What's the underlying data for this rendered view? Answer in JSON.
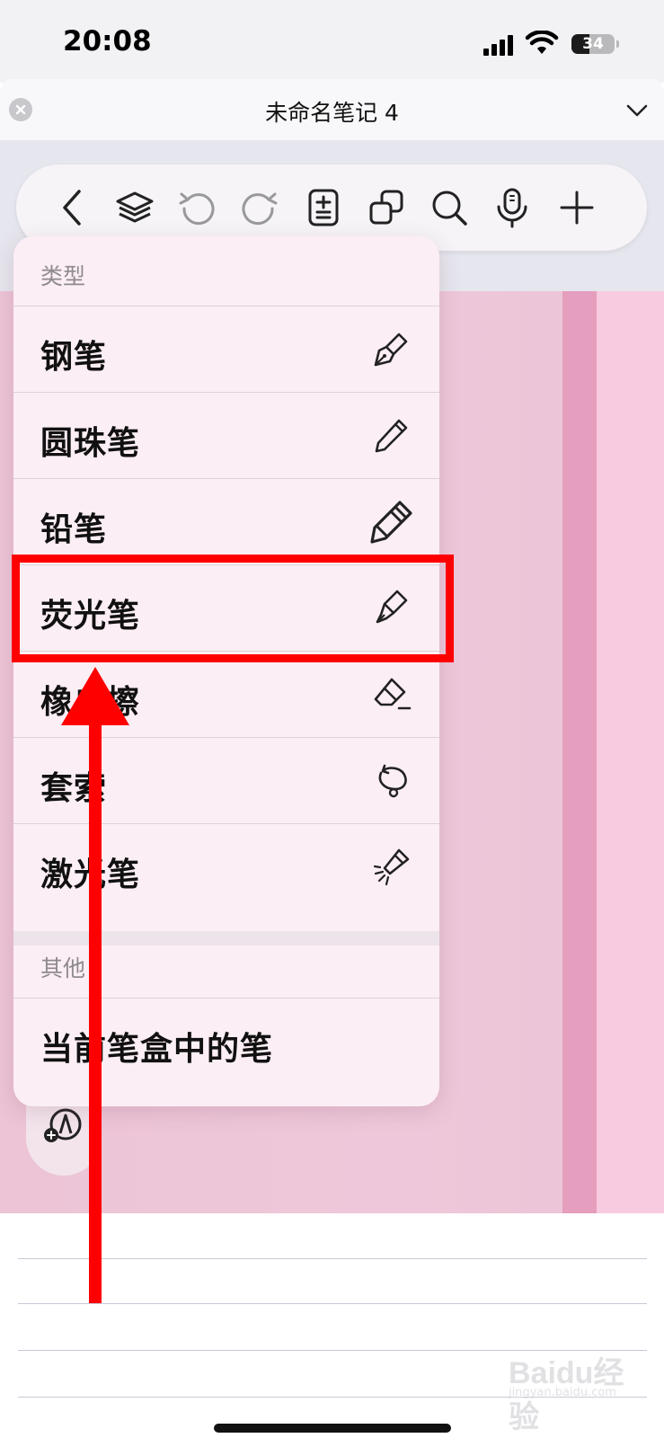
{
  "status_bar": {
    "time": "20:08",
    "battery": "34"
  },
  "title_bar": {
    "title": "未命名笔记 4"
  },
  "toolbar": {
    "icons": [
      "back-icon",
      "layers-icon",
      "undo-icon",
      "redo-icon",
      "page-list-icon",
      "copy-icon",
      "search-icon",
      "microphone-icon",
      "add-icon"
    ]
  },
  "menu": {
    "section_type": "类型",
    "items": [
      {
        "label": "钢笔",
        "icon": "fountain-pen-icon"
      },
      {
        "label": "圆珠笔",
        "icon": "ballpoint-pen-icon"
      },
      {
        "label": "铅笔",
        "icon": "pencil-icon"
      },
      {
        "label": "荧光笔",
        "icon": "highlighter-icon"
      },
      {
        "label": "橡皮擦",
        "icon": "eraser-icon"
      },
      {
        "label": "套索",
        "icon": "lasso-icon"
      },
      {
        "label": "激光笔",
        "icon": "laser-pointer-icon"
      }
    ],
    "section_other": "其他",
    "other_item": "当前笔盒中的笔"
  },
  "annotation": {
    "highlight_color": "#ff0000"
  },
  "watermark": {
    "main": "Baidu经验",
    "sub": "jingyan.baidu.com"
  }
}
